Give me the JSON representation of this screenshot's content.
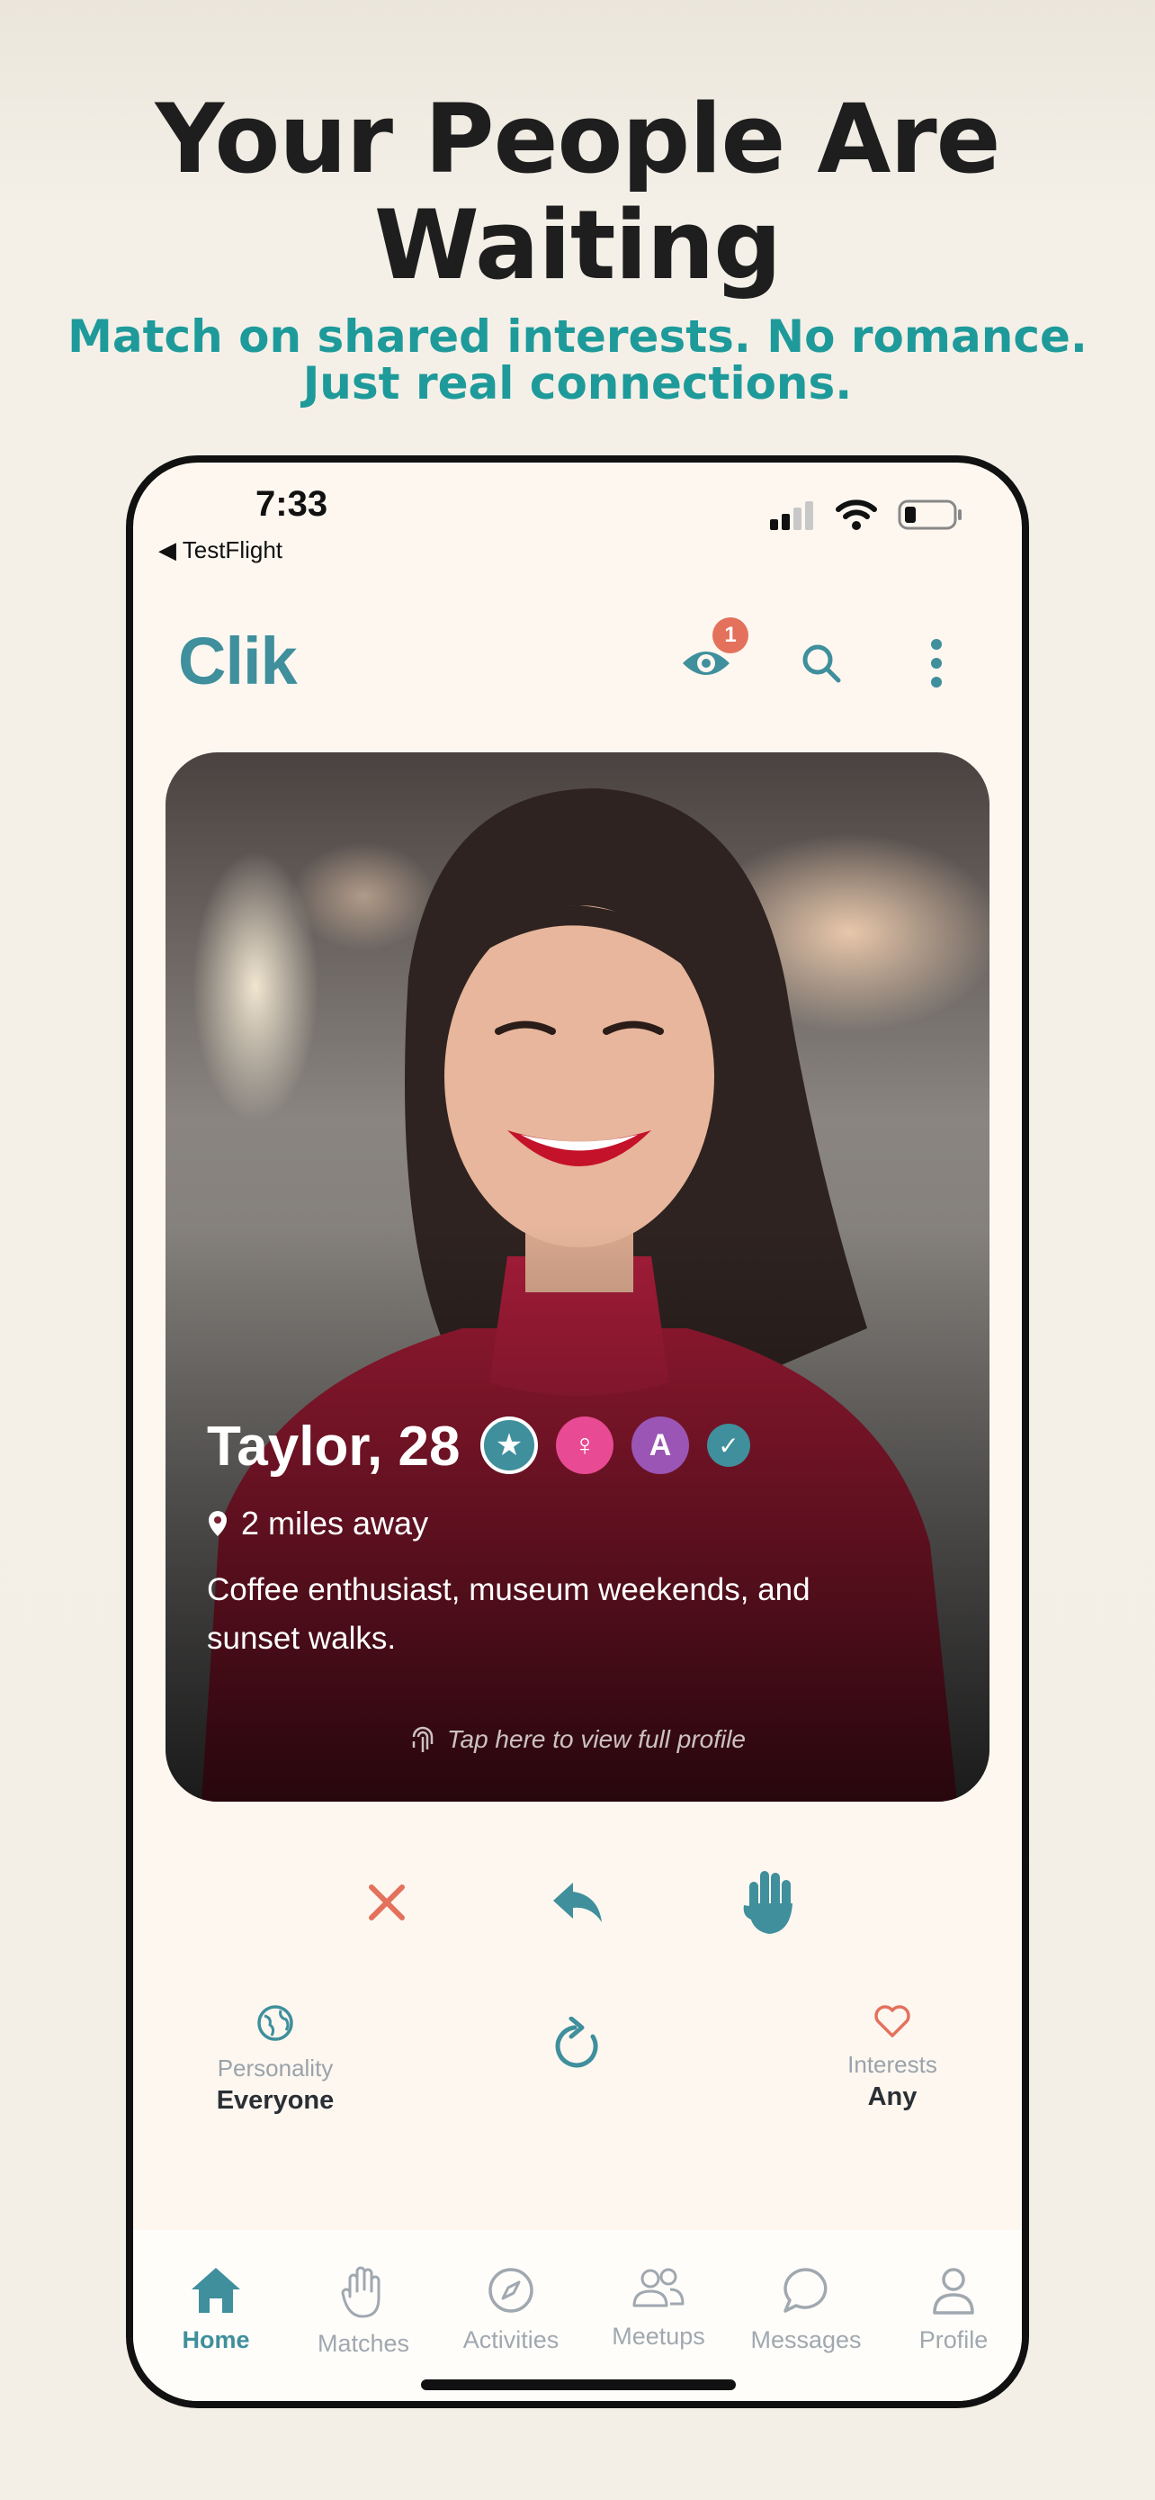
{
  "promo": {
    "headline_line1": "Your People Are",
    "headline_line2": "Waiting",
    "subline_line1": "Match on shared interests. No romance.",
    "subline_line2": "Just real connections."
  },
  "status_bar": {
    "time": "7:33",
    "back_label": "◀ TestFlight"
  },
  "header": {
    "app_name": "Clik",
    "viewers_badge": "1"
  },
  "profile_card": {
    "name_age": "Taylor, 28",
    "badges": [
      {
        "icon": "star-icon",
        "color": "#3f8f9c"
      },
      {
        "icon": "female-icon",
        "color": "#e84a93"
      },
      {
        "text": "A",
        "color": "#9a55b5"
      },
      {
        "icon": "verified-check-icon",
        "color": "#3f8f9c"
      }
    ],
    "distance": "2 miles away",
    "bio": "Coffee enthusiast, museum weekends, and sunset walks.",
    "hint": "Tap here to view full profile"
  },
  "filters": {
    "left": {
      "label": "Personality",
      "value": "Everyone"
    },
    "right": {
      "label": "Interests",
      "value": "Any"
    }
  },
  "tabs": [
    {
      "label": "Home",
      "icon": "home-icon",
      "active": true
    },
    {
      "label": "Matches",
      "icon": "hand-icon"
    },
    {
      "label": "Activities",
      "icon": "compass-icon"
    },
    {
      "label": "Meetups",
      "icon": "people-icon"
    },
    {
      "label": "Messages",
      "icon": "chat-icon"
    },
    {
      "label": "Profile",
      "icon": "person-icon"
    }
  ],
  "colors": {
    "accent": "#3f8f9c",
    "promo_teal": "#1e9a9a",
    "reject": "#e4715c",
    "background": "#fdf7f0"
  }
}
